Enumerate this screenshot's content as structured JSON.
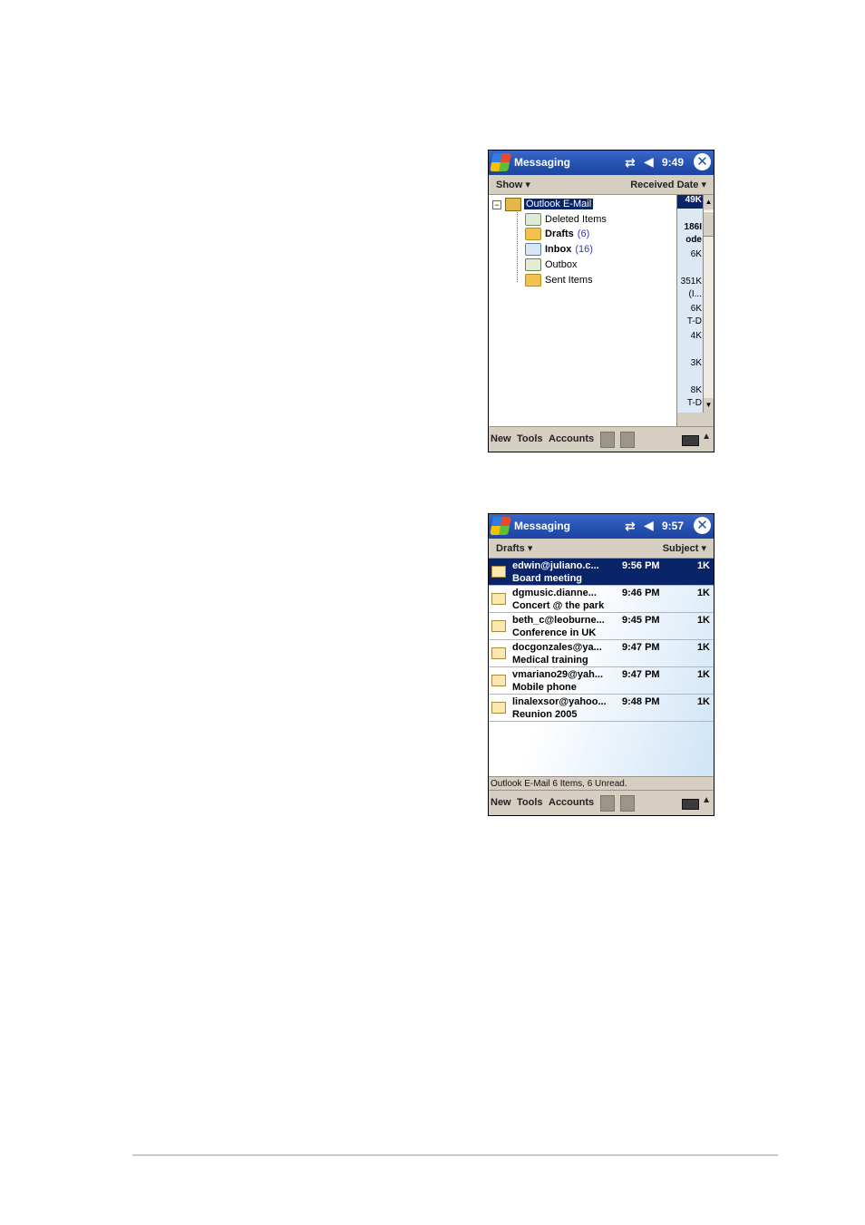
{
  "screen1": {
    "title": "Messaging",
    "clock": "9:49",
    "sort_left": "Show ▾",
    "sort_right": "Received Date ▾",
    "tree": {
      "root": "Outlook E-Mail",
      "folders": [
        {
          "label": "Deleted Items",
          "count": ""
        },
        {
          "label": "Drafts",
          "count": "(6)"
        },
        {
          "label": "Inbox",
          "count": "(16)"
        },
        {
          "label": "Outbox",
          "count": ""
        },
        {
          "label": "Sent Items",
          "count": ""
        }
      ]
    },
    "behind": [
      "49K",
      "186I",
      "ode",
      "6K",
      "351K",
      "(I...",
      "6K",
      "T-D",
      "4K",
      "3K",
      "8K",
      "T-D"
    ],
    "commands": {
      "new": "New",
      "tools": "Tools",
      "accounts": "Accounts"
    }
  },
  "screen2": {
    "title": "Messaging",
    "clock": "9:57",
    "folder_menu": "Drafts ▾",
    "sort_menu": "Subject ▾",
    "messages": [
      {
        "from": "edwin@juliano.c...",
        "subject": "Board meeting",
        "time": "9:56 PM",
        "size": "1K"
      },
      {
        "from": "dgmusic.dianne...",
        "subject": "Concert @ the park",
        "time": "9:46 PM",
        "size": "1K"
      },
      {
        "from": "beth_c@leoburne...",
        "subject": "Conference in UK",
        "time": "9:45 PM",
        "size": "1K"
      },
      {
        "from": "docgonzales@ya...",
        "subject": "Medical training",
        "time": "9:47 PM",
        "size": "1K"
      },
      {
        "from": "vmariano29@yah...",
        "subject": "Mobile phone",
        "time": "9:47 PM",
        "size": "1K"
      },
      {
        "from": "linalexsor@yahoo...",
        "subject": "Reunion 2005",
        "time": "9:48 PM",
        "size": "1K"
      }
    ],
    "status": "Outlook E-Mail  6 Items, 6 Unread.",
    "commands": {
      "new": "New",
      "tools": "Tools",
      "accounts": "Accounts"
    }
  }
}
